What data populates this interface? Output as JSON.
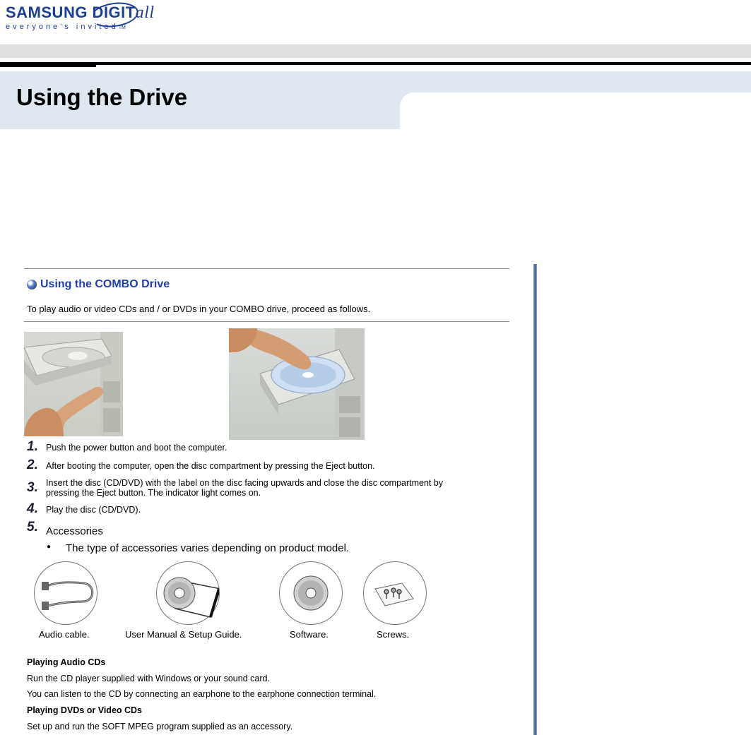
{
  "header": {
    "brand_text": "SAMSUNG DIGIT",
    "brand_italic": "all",
    "tagline": "everyone's invited",
    "tagline_tm": "TM",
    "page_title": "Using the Drive"
  },
  "section": {
    "title": "Using the COMBO Drive",
    "intro": "To play audio or video CDs and / or DVDs in your COMBO drive, proceed as follows."
  },
  "steps": [
    {
      "num": "1.",
      "text": "Push the power button and boot the computer."
    },
    {
      "num": "2.",
      "text": "After booting the computer, open the disc compartment by pressing the Eject button."
    },
    {
      "num": "3.",
      "text": "Insert the disc (CD/DVD) with the label on the disc facing upwards and close the disc compartment by",
      "text2": "pressing the Eject button. The indicator light comes on."
    },
    {
      "num": "4.",
      "text": "Play the disc (CD/DVD)."
    },
    {
      "num": "5.",
      "text": "Accessories"
    }
  ],
  "accessories": {
    "note": "The type of accessories varies depending on product model.",
    "items": [
      {
        "label": "Audio cable.",
        "icon": "audio-cable-icon"
      },
      {
        "label": "User Manual & Setup Guide.",
        "icon": "cd-manual-icon"
      },
      {
        "label": "Software.",
        "icon": "cd-icon"
      },
      {
        "label": "Screws.",
        "icon": "screws-bag-icon"
      }
    ]
  },
  "playing": {
    "audio_heading": "Playing Audio CDs",
    "audio_line1": "Run the CD player supplied with Windows or your sound card.",
    "audio_line2": "You can listen to the CD by connecting an earphone to the earphone connection terminal.",
    "video_heading": "Playing DVDs or Video CDs",
    "video_line1": "Set up and run the SOFT MPEG program supplied as an accessory."
  },
  "colors": {
    "brand": "#1c3f94",
    "section_title": "#1f3fb5",
    "banner": "#dfe8f0"
  }
}
